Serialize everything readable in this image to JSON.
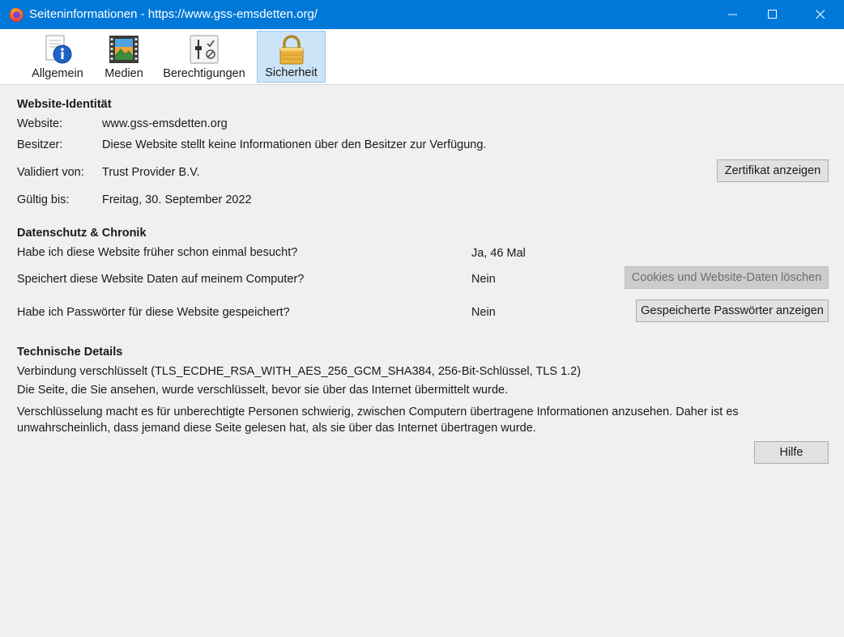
{
  "window": {
    "title": "Seiteninformationen - https://www.gss-emsdetten.org/"
  },
  "tabs": [
    {
      "label": "Allgemein",
      "icon": "info-document-icon"
    },
    {
      "label": "Medien",
      "icon": "media-film-icon"
    },
    {
      "label": "Berechtigungen",
      "icon": "permissions-toggle-icon"
    },
    {
      "label": "Sicherheit",
      "icon": "padlock-icon",
      "active": true
    }
  ],
  "identity": {
    "heading": "Website-Identität",
    "website_label": "Website:",
    "website_value": "www.gss-emsdetten.org",
    "owner_label": "Besitzer:",
    "owner_value": "Diese Website stellt keine Informationen über den Besitzer zur Verfügung.",
    "validated_label": "Validiert von:",
    "validated_value": "Trust Provider B.V.",
    "cert_button": "Zertifikat anzeigen",
    "valid_until_label": "Gültig bis:",
    "valid_until_value": "Freitag, 30. September 2022"
  },
  "privacy": {
    "heading": "Datenschutz & Chronik",
    "q_visited": "Habe ich diese Website früher schon einmal besucht?",
    "a_visited": "Ja, 46 Mal",
    "q_data": "Speichert diese Website Daten auf meinem Computer?",
    "a_data": "Nein",
    "clear_button": "Cookies und Website-Daten löschen",
    "q_passwords": "Habe ich Passwörter für diese Website gespeichert?",
    "a_passwords": "Nein",
    "passwords_button": "Gespeicherte Passwörter anzeigen"
  },
  "technical": {
    "heading": "Technische Details",
    "line1": "Verbindung verschlüsselt (TLS_ECDHE_RSA_WITH_AES_256_GCM_SHA384, 256-Bit-Schlüssel, TLS 1.2)",
    "line2": "Die Seite, die Sie ansehen, wurde verschlüsselt, bevor sie über das Internet übermittelt wurde.",
    "line3": "Verschlüsselung macht es für unberechtigte Personen schwierig, zwischen Computern übertragene Informationen anzusehen. Daher ist es unwahrscheinlich, dass jemand diese Seite gelesen hat, als sie über das Internet übertragen wurde."
  },
  "help_button": "Hilfe",
  "colors": {
    "titlebar": "#0078d7",
    "active_tab": "#cce4f7",
    "background": "#f0f0f0"
  }
}
